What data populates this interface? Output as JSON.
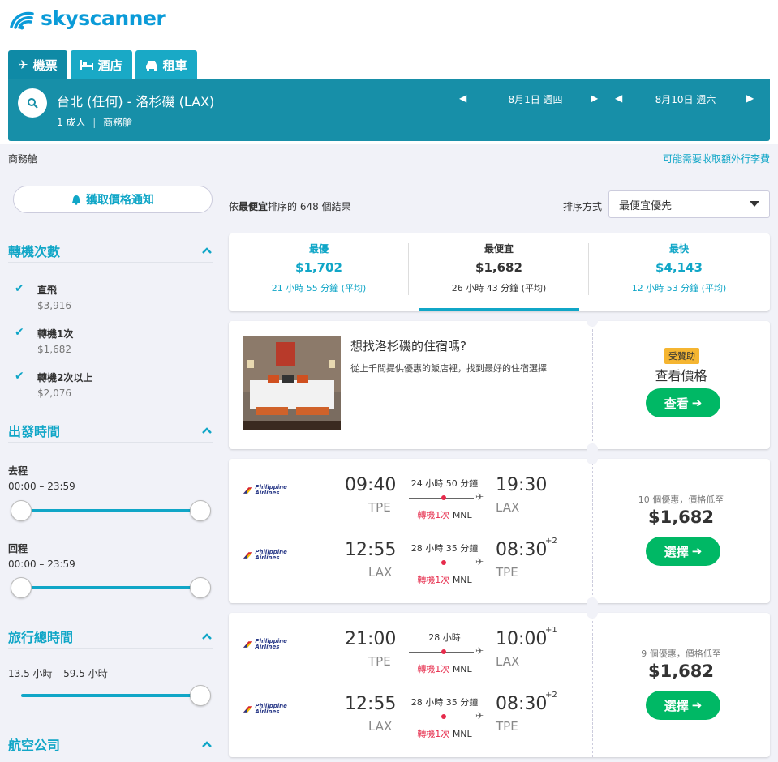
{
  "brand": {
    "name": "skyscanner",
    "color": "#0b9bd8"
  },
  "tabs": [
    {
      "label": "機票",
      "icon": "plane-icon"
    },
    {
      "label": "酒店",
      "icon": "bed-icon"
    },
    {
      "label": "租車",
      "icon": "car-icon"
    }
  ],
  "search": {
    "route": "台北 (任何) - 洛杉磯 (LAX)",
    "passengers": "1 成人",
    "cabin": "商務艙",
    "depart_date": "8月1日 週四",
    "return_date": "8月10日 週六"
  },
  "cabin_note": "商務艙",
  "baggage_note": "可能需要收取額外行李費",
  "price_alert_label": "獲取價格通知",
  "filters": {
    "stops": {
      "title": "轉機次數",
      "items": [
        {
          "label": "直飛",
          "price": "$3,916",
          "checked": true
        },
        {
          "label": "轉機1次",
          "price": "$1,682",
          "checked": true
        },
        {
          "label": "轉機2次以上",
          "price": "$2,076",
          "checked": true
        }
      ]
    },
    "depart_times": {
      "title": "出發時間",
      "outbound_label": "去程",
      "outbound_range": "00:00 – 23:59",
      "return_label": "回程",
      "return_range": "00:00 – 23:59"
    },
    "duration": {
      "title": "旅行總時間",
      "range": "13.5 小時 – 59.5 小時"
    },
    "airlines": {
      "title": "航空公司"
    }
  },
  "results": {
    "count_text": "依最便宜排序的 648 個結果",
    "prefix": "依",
    "bold": "最便宜",
    "suffix": "排序的 648 個結果"
  },
  "sort": {
    "label": "排序方式",
    "selected": "最便宜優先"
  },
  "summary": [
    {
      "label": "最優",
      "price": "$1,702",
      "duration": "21 小時 55 分鐘 (平均)"
    },
    {
      "label": "最便宜",
      "price": "$1,682",
      "duration": "26 小時 43 分鐘 (平均)"
    },
    {
      "label": "最快",
      "price": "$4,143",
      "duration": "12 小時 53 分鐘 (平均)"
    }
  ],
  "hotel_ad": {
    "title": "想找洛杉磯的住宿嗎?",
    "desc": "從上千間提供優惠的飯店裡，找到最好的住宿選擇",
    "sponsored": "受贊助",
    "cta_title": "查看價格",
    "button": "查看"
  },
  "flights": [
    {
      "airline": "Philippine Airlines",
      "legs": [
        {
          "dep_time": "09:40",
          "dep_code": "TPE",
          "duration": "24 小時 50 分鐘",
          "stops": "轉機1次",
          "via": "MNL",
          "arr_time": "19:30",
          "arr_code": "LAX",
          "day_offset": ""
        },
        {
          "dep_time": "12:55",
          "dep_code": "LAX",
          "duration": "28 小時 35 分鐘",
          "stops": "轉機1次",
          "via": "MNL",
          "arr_time": "08:30",
          "arr_code": "TPE",
          "day_offset": "+2"
        }
      ],
      "deals": "10 個優惠，價格低至",
      "price": "$1,682",
      "button": "選擇"
    },
    {
      "airline": "Philippine Airlines",
      "legs": [
        {
          "dep_time": "21:00",
          "dep_code": "TPE",
          "duration": "28 小時",
          "stops": "轉機1次",
          "via": "MNL",
          "arr_time": "10:00",
          "arr_code": "LAX",
          "day_offset": "+1"
        },
        {
          "dep_time": "12:55",
          "dep_code": "LAX",
          "duration": "28 小時 35 分鐘",
          "stops": "轉機1次",
          "via": "MNL",
          "arr_time": "08:30",
          "arr_code": "TPE",
          "day_offset": "+2"
        }
      ],
      "deals": "9 個優惠，價格低至",
      "price": "$1,682",
      "button": "選擇"
    }
  ],
  "colors": {
    "accent": "#10a6c7",
    "bar": "#178fa8",
    "cta": "#00b865",
    "stop": "#e62b4b"
  }
}
